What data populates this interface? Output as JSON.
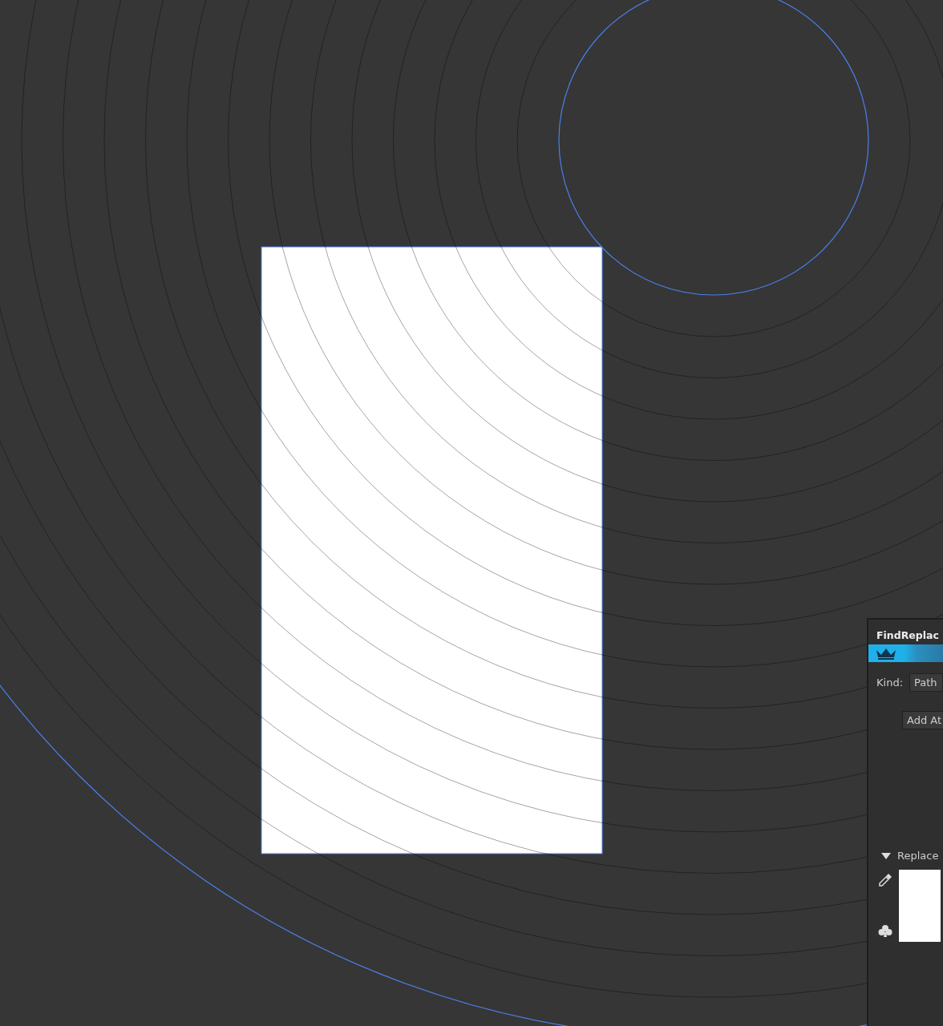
{
  "panel": {
    "title": "FindReplac",
    "kind_label": "Kind:",
    "kind_value": "Path",
    "add_button": "Add At",
    "replace_section": {
      "label": "Replace",
      "expanded": true
    }
  }
}
